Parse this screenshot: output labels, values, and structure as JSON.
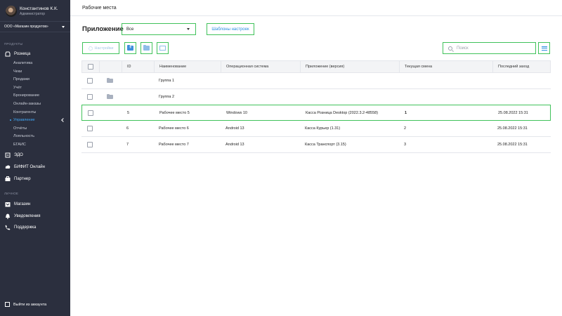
{
  "sidebar": {
    "profile": {
      "name": "Константинов К.К.",
      "role": "Администратор"
    },
    "org": "ООО «Магазин продуктов»",
    "section_products": "ПРОДУКТЫ",
    "section_personal": "ЛИЧНОЕ",
    "main_items": [
      {
        "label": "Розница",
        "icon": "retail-icon"
      },
      {
        "label": "ЭДО",
        "icon": "edo-icon"
      },
      {
        "label": "БИФИТ Онлайн",
        "icon": "cloud-icon"
      },
      {
        "label": "Партнер",
        "icon": "partner-icon"
      },
      {
        "label": "Магазин",
        "icon": "store-icon"
      },
      {
        "label": "Уведомления",
        "icon": "bell-icon"
      },
      {
        "label": "Поддержка",
        "icon": "phone-icon"
      }
    ],
    "retail_subitems": [
      "Аналитика",
      "Чеки",
      "Продажи",
      "Учёт",
      "Бронирование",
      "Онлайн-заказы",
      "Контрагенты",
      "Управление",
      "Отчёты",
      "Лояльность",
      "ЕГАИС"
    ],
    "active_subitem": "Управление",
    "logout": "Выйти из аккаунта"
  },
  "header": {
    "title": "Рабочие места"
  },
  "filters": {
    "app_label": "Приложение",
    "app_value": "Все",
    "templates_button": "Шаблоны настроек"
  },
  "toolbar": {
    "settings_label": "Настройки",
    "search_placeholder": "Поиск"
  },
  "table": {
    "columns": [
      "ID",
      "Наименование",
      "Операционная система",
      "Приложение (версия)",
      "Текущая смена",
      "Последний заход"
    ],
    "rows": [
      {
        "type": "group",
        "id": "",
        "name": "Группа 1",
        "os": "",
        "app": "",
        "shift": "",
        "last": ""
      },
      {
        "type": "group",
        "id": "",
        "name": "Группа 2",
        "os": "",
        "app": "",
        "shift": "",
        "last": ""
      },
      {
        "type": "workplace",
        "id": "5",
        "name": "Рабочее место 5",
        "os": "Windows 10",
        "app": "Касса Розница Desktop (2022.3.2-48558)",
        "shift": "1",
        "last": "25.08.2022 15:31"
      },
      {
        "type": "workplace",
        "id": "6",
        "name": "Рабочее место 6",
        "os": "Android 13",
        "app": "Касса Курьер (1.31)",
        "shift": "2",
        "last": "25.08.2022 15:31"
      },
      {
        "type": "workplace",
        "id": "7",
        "name": "Рабочее место 7",
        "os": "Android 13",
        "app": "Касса Транспорт (3.15)",
        "shift": "3",
        "last": "25.08.2022 15:31"
      }
    ]
  },
  "colors": {
    "sidebar_bg": "#2b2f3e",
    "accent": "#40c25a",
    "link": "#2a8de0",
    "active_nav": "#3fa6f5"
  }
}
